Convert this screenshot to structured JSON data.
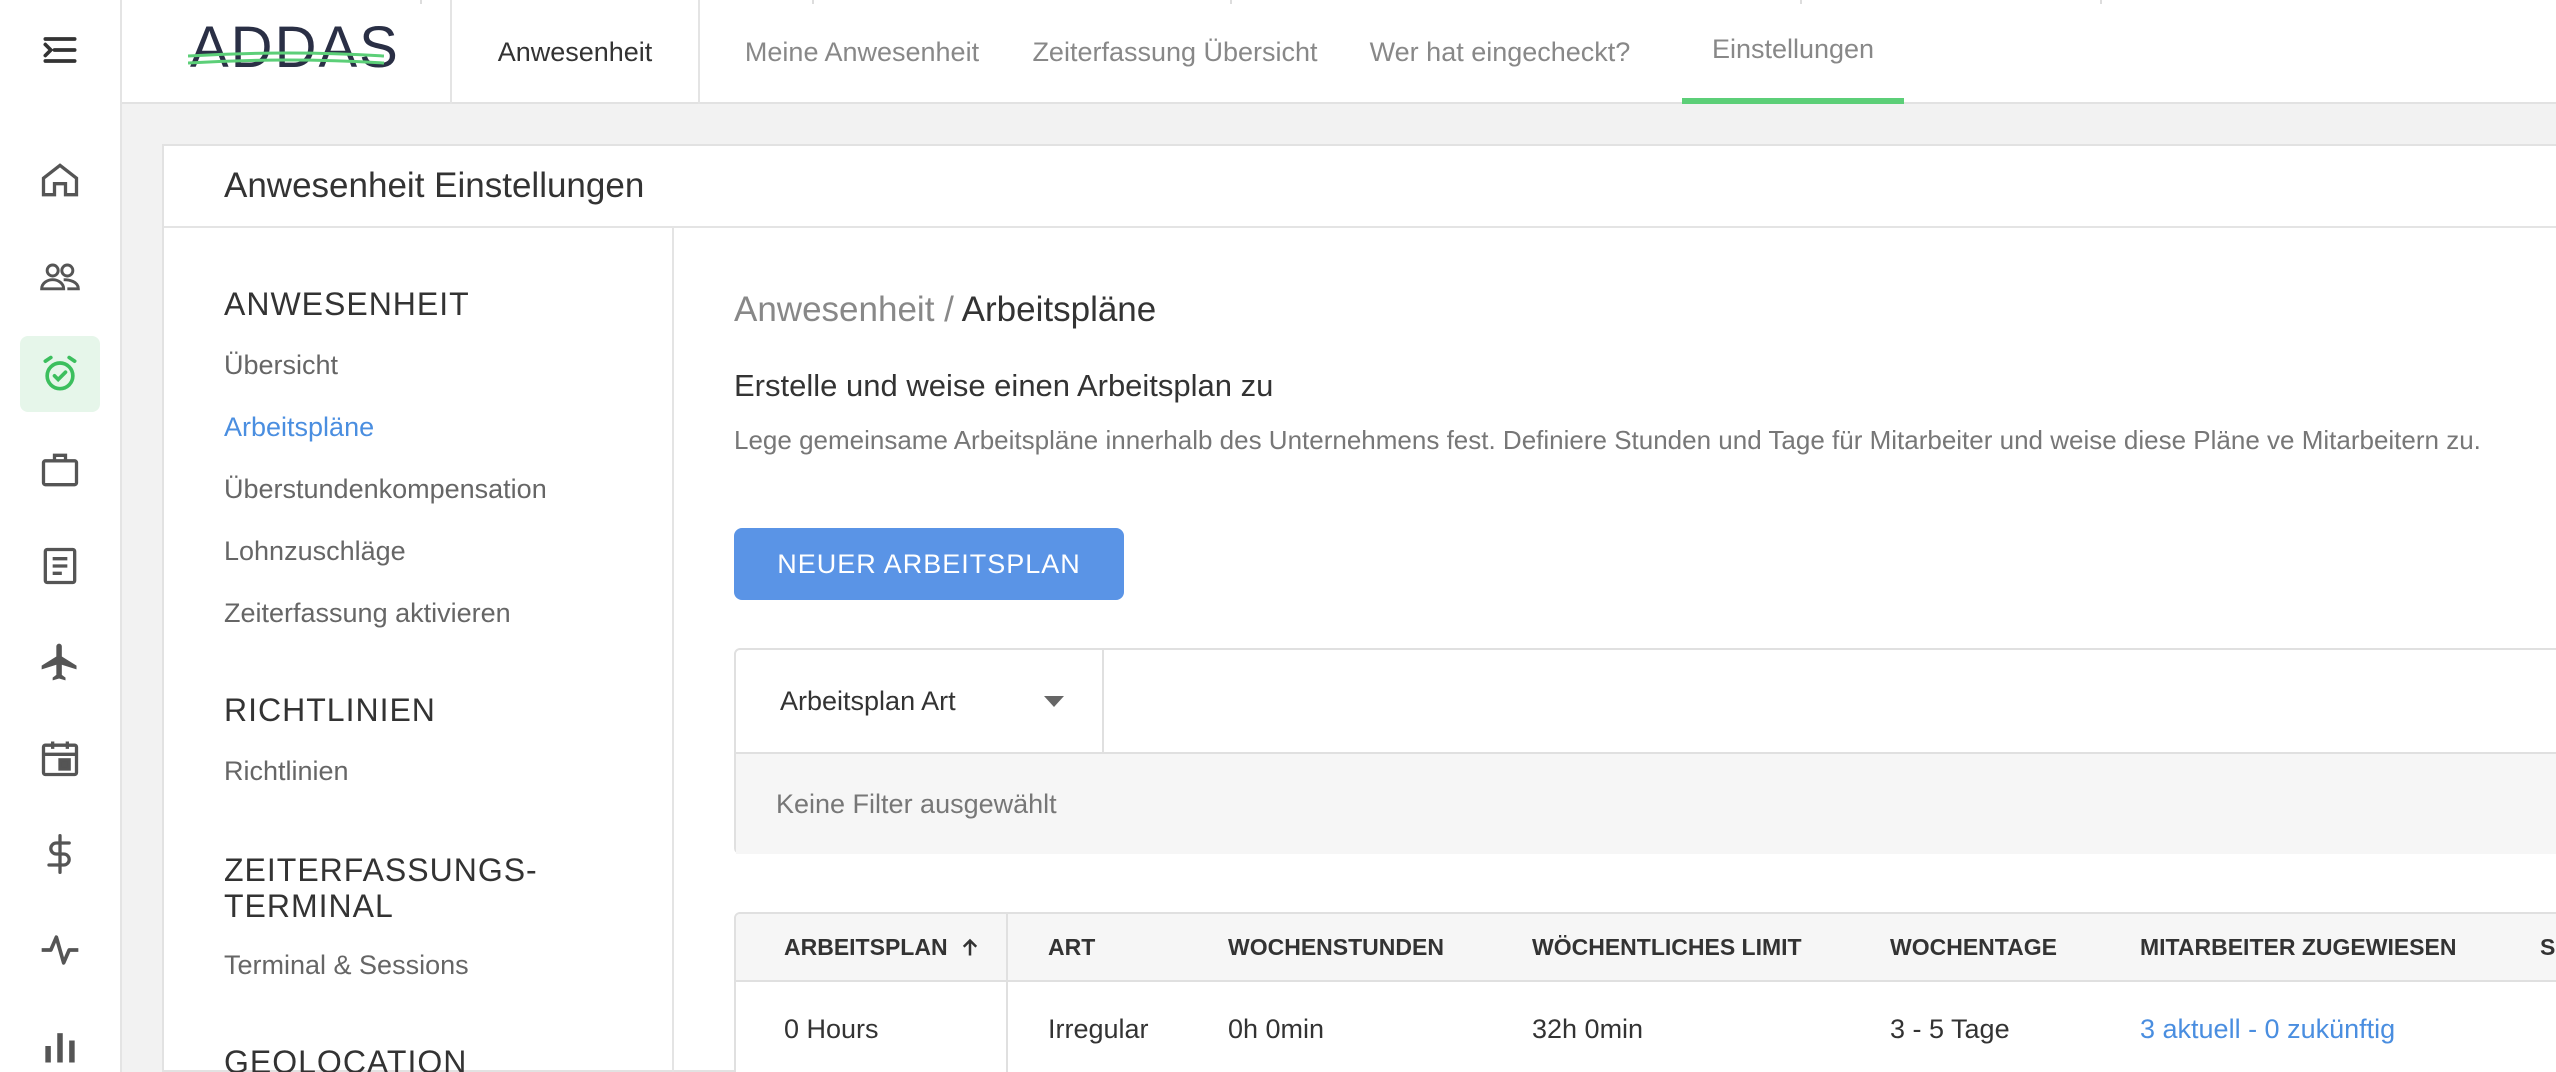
{
  "nav_icons": [
    "menu-collapse-icon",
    "home-icon",
    "people-icon",
    "alarm-clock-icon",
    "briefcase-icon",
    "document-icon",
    "airplane-icon",
    "calendar-icon",
    "dollar-icon",
    "pulse-icon",
    "bar-chart-icon"
  ],
  "colors": {
    "accent_green": "#5ccf78",
    "link_blue": "#4a8ee0",
    "button_blue": "#5a94e6"
  },
  "topbar": {
    "logo": "ADDAS",
    "section": "Anwesenheit",
    "tabs": [
      {
        "label": "Meine Anwesenheit"
      },
      {
        "label": "Zeiterfassung Übersicht"
      },
      {
        "label": "Wer hat eingecheckt?"
      },
      {
        "label": "Einstellungen",
        "active": true
      }
    ]
  },
  "page": {
    "title": "Anwesenheit Einstellungen",
    "breadcrumb": {
      "parent": "Anwesenheit /",
      "current": "Arbeitspläne"
    },
    "heading": "Erstelle und weise einen Arbeitsplan zu",
    "description": "Lege gemeinsame Arbeitspläne innerhalb des Unternehmens fest. Definiere Stunden und Tage für Mitarbeiter und weise diese Pläne ve Mitarbeitern zu.",
    "new_button": "NEUER ARBEITSPLAN"
  },
  "subnav": {
    "groups": [
      {
        "title": "ANWESENHEIT",
        "items": [
          "Übersicht",
          "Arbeitspläne",
          "Überstundenkompensation",
          "Lohnzuschläge",
          "Zeiterfassung aktivieren"
        ]
      },
      {
        "title": "RICHTLINIEN",
        "items": [
          "Richtlinien"
        ]
      },
      {
        "title_line1": "ZEITERFASSUNGS-",
        "title_line2": "TERMINAL",
        "items": [
          "Terminal & Sessions"
        ]
      },
      {
        "title": "GEOLOCATION",
        "items": []
      }
    ],
    "active_item": "Arbeitspläne"
  },
  "filter": {
    "select_label": "Arbeitsplan Art",
    "empty_text": "Keine Filter ausgewählt"
  },
  "table": {
    "columns": [
      "ARBEITSPLAN",
      "ART",
      "WOCHENSTUNDEN",
      "WÖCHENTLICHES LIMIT",
      "WOCHENTAGE",
      "MITARBEITER ZUGEWIESEN",
      "S"
    ],
    "rows": [
      [
        "0 Hours",
        "Irregular",
        "0h 0min",
        "32h 0min",
        "3 - 5 Tage",
        "3 aktuell - 0 zukünftig"
      ]
    ]
  }
}
